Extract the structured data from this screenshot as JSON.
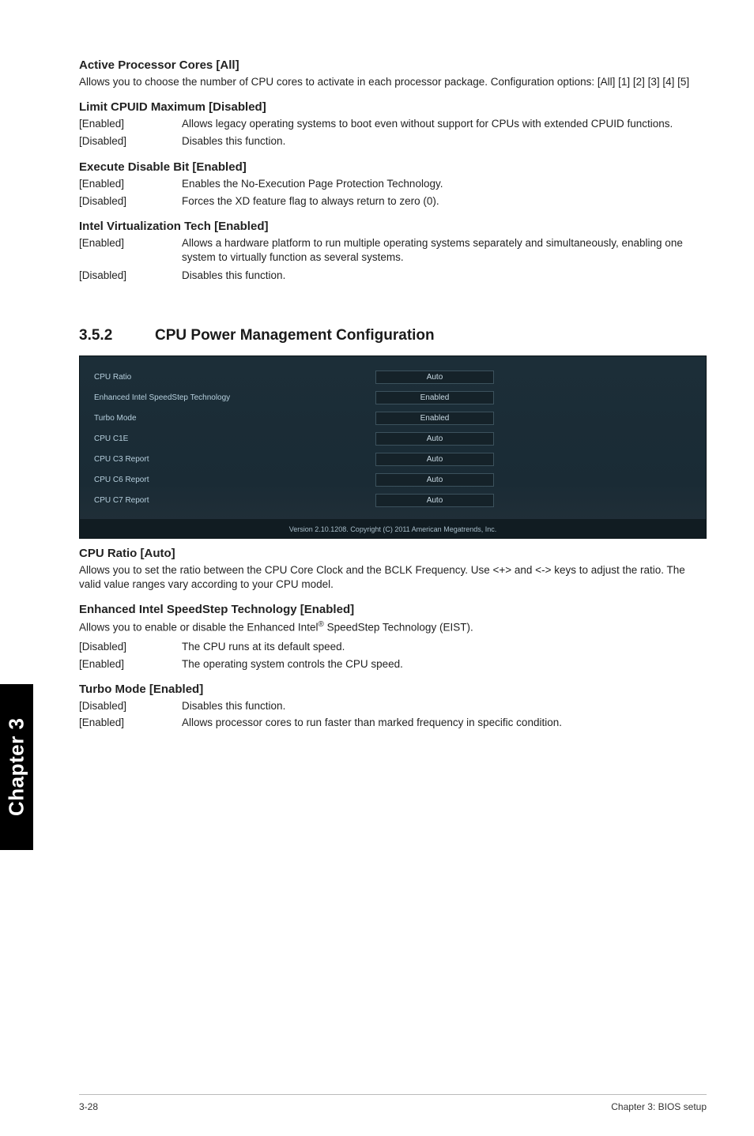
{
  "sideTab": "Chapter 3",
  "s1": {
    "h": "Active Processor Cores [All]",
    "p": "Allows you to choose the number of CPU cores to activate in each processor package. Configuration options: [All] [1] [2] [3] [4] [5]"
  },
  "s2": {
    "h": "Limit CPUID Maximum [Disabled]",
    "rows": [
      {
        "k": "[Enabled]",
        "v": "Allows legacy operating systems to boot even without support for CPUs with extended CPUID functions."
      },
      {
        "k": "[Disabled]",
        "v": "Disables this function."
      }
    ]
  },
  "s3": {
    "h": "Execute Disable Bit [Enabled]",
    "rows": [
      {
        "k": "[Enabled]",
        "v": "Enables the No-Execution Page Protection Technology."
      },
      {
        "k": "[Disabled]",
        "v": "Forces the XD feature flag to always return to zero (0)."
      }
    ]
  },
  "s4": {
    "h": "Intel Virtualization Tech [Enabled]",
    "rows": [
      {
        "k": "[Enabled]",
        "v": "Allows a hardware platform to run multiple operating systems separately and simultaneously, enabling one system to virtually function as several systems."
      },
      {
        "k": "[Disabled]",
        "v": "Disables this function."
      }
    ]
  },
  "section": {
    "num": "3.5.2",
    "title": "CPU Power Management Configuration"
  },
  "bios": {
    "rows": [
      {
        "label": "CPU Ratio",
        "value": "Auto"
      },
      {
        "label": "Enhanced Intel SpeedStep Technology",
        "value": "Enabled"
      },
      {
        "label": "Turbo Mode",
        "value": "Enabled"
      },
      {
        "label": "CPU C1E",
        "value": "Auto"
      },
      {
        "label": "CPU C3 Report",
        "value": "Auto"
      },
      {
        "label": "CPU C6 Report",
        "value": "Auto"
      },
      {
        "label": "CPU C7 Report",
        "value": "Auto"
      }
    ],
    "footer": "Version 2.10.1208.  Copyright (C) 2011 American Megatrends, Inc."
  },
  "s5": {
    "h": "CPU Ratio [Auto]",
    "p": "Allows you to set the ratio between the CPU Core Clock and the BCLK Frequency. Use <+> and <-> keys to adjust the ratio. The valid value ranges vary according to your CPU model."
  },
  "s6": {
    "h": "Enhanced Intel SpeedStep Technology [Enabled]",
    "p1a": "Allows you to enable or disable the Enhanced Intel",
    "p1sup": "®",
    "p1b": " SpeedStep Technology (EIST).",
    "rows": [
      {
        "k": "[Disabled]",
        "v": "The CPU runs at its default speed."
      },
      {
        "k": "[Enabled]",
        "v": "The operating system controls the CPU speed."
      }
    ]
  },
  "s7": {
    "h": "Turbo Mode [Enabled]",
    "rows": [
      {
        "k": "[Disabled]",
        "v": "Disables this function."
      },
      {
        "k": "[Enabled]",
        "v": "Allows processor cores to run faster than marked frequency in specific condition."
      }
    ]
  },
  "footer": {
    "left": "3-28",
    "right": "Chapter 3: BIOS setup"
  }
}
